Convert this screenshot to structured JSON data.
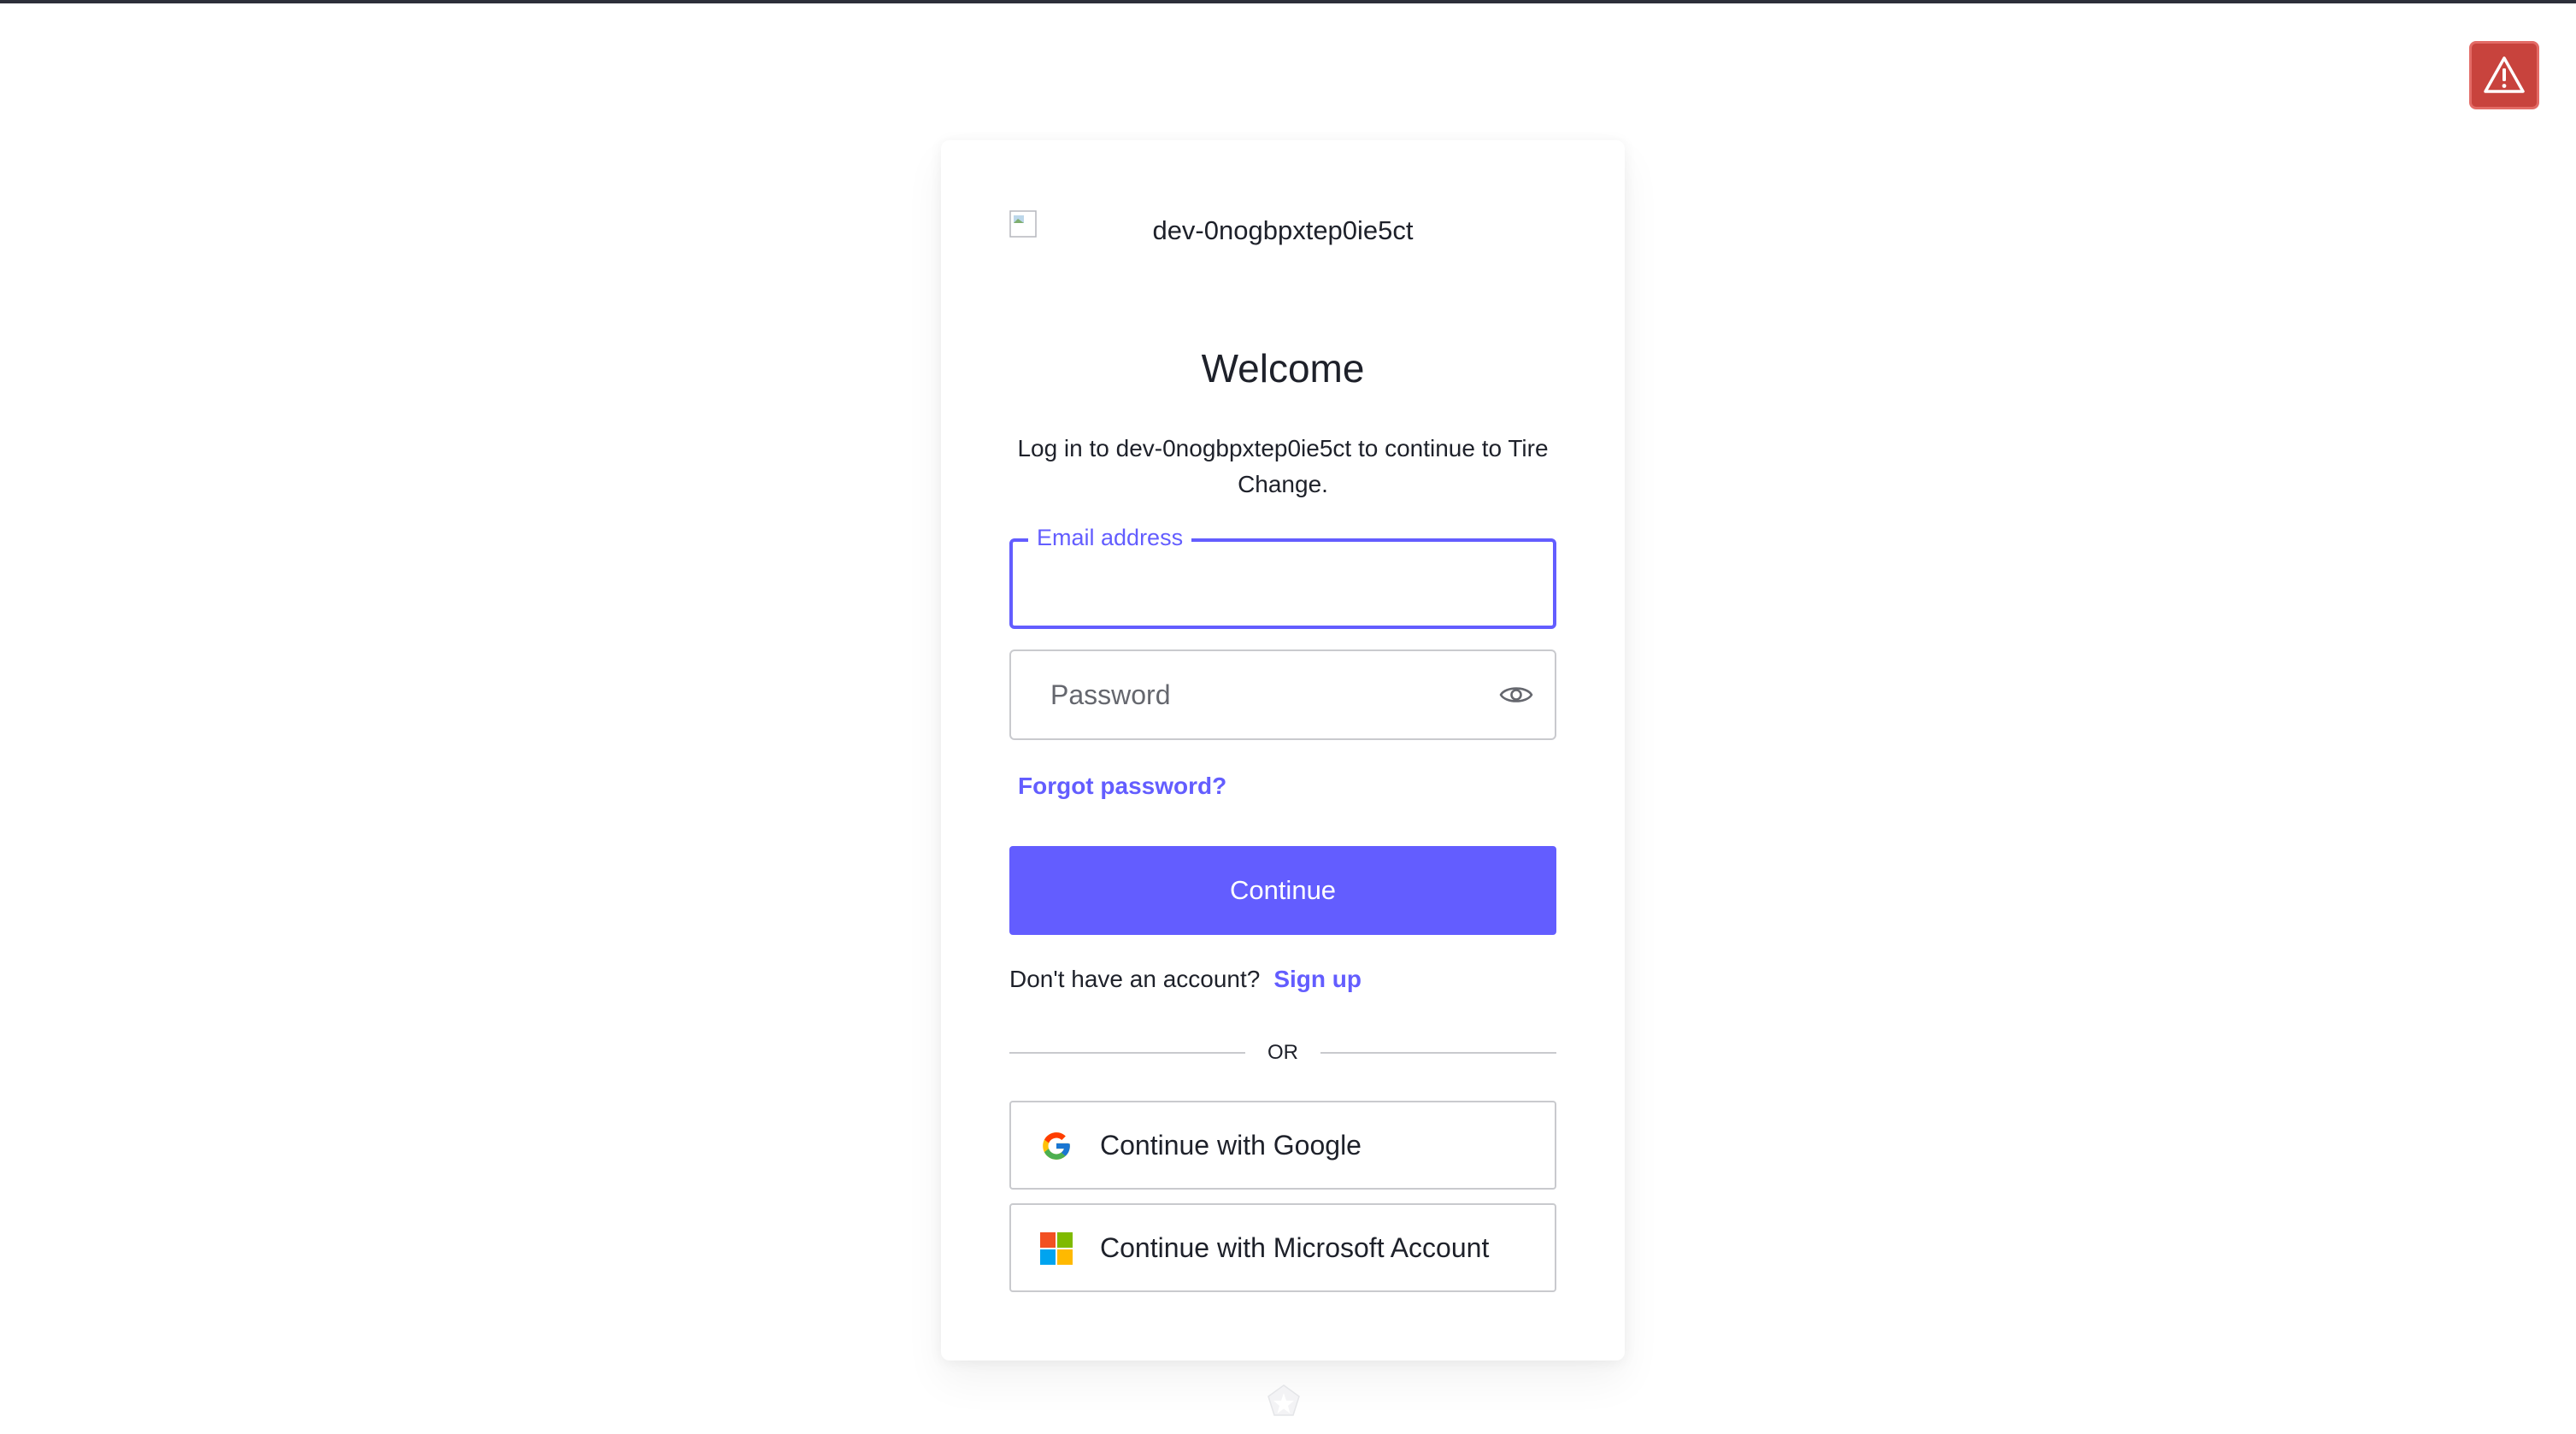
{
  "page": {
    "alert_icon": "warning-triangle-icon",
    "footer_icon": "star-badge-icon"
  },
  "card": {
    "logo_alt": "dev-0nogbpxtep0ie5ct",
    "title": "Welcome",
    "subtitle": "Log in to dev-0nogbpxtep0ie5ct to continue to Tire Change.",
    "email": {
      "label": "Email address",
      "value": ""
    },
    "password": {
      "placeholder": "Password",
      "toggle_icon": "eye-icon"
    },
    "forgot_password": "Forgot password?",
    "continue": "Continue",
    "signup": {
      "prompt": "Don't have an account?",
      "link": "Sign up"
    },
    "divider": "OR",
    "social": [
      {
        "label": "Continue with Google",
        "icon": "google-icon"
      },
      {
        "label": "Continue with Microsoft Account",
        "icon": "microsoft-icon"
      }
    ]
  },
  "colors": {
    "accent": "#635dff",
    "text": "#1e212a",
    "alert_bg": "#c8433d",
    "border": "#c9cace"
  }
}
